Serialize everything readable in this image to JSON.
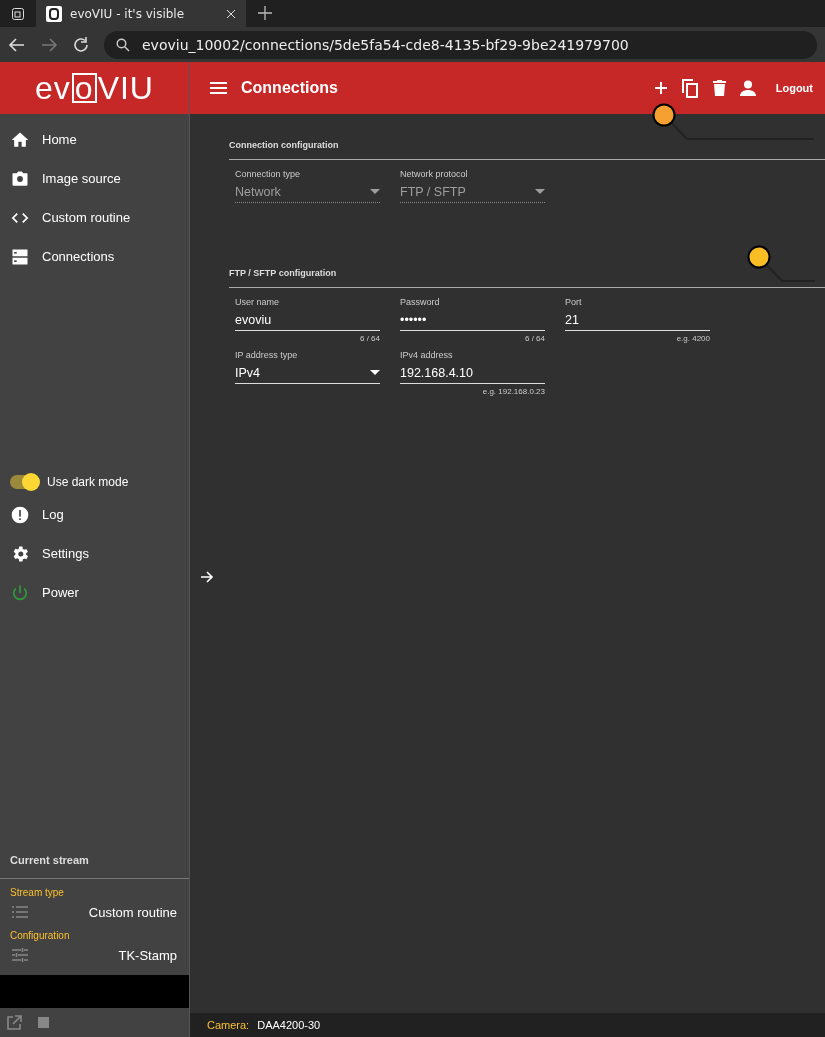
{
  "browser": {
    "tab_title": "evoVIU - it's visible",
    "url": "evoviu_10002/connections/5de5fa54-cde8-4135-bf29-9be241979700"
  },
  "logo": {
    "before": "ev",
    "boxed": "o",
    "after": "VIU"
  },
  "header": {
    "title": "Connections",
    "logout": "Logout"
  },
  "sidebar": {
    "nav": [
      {
        "kind": "home",
        "label": "Home"
      },
      {
        "kind": "camera",
        "label": "Image source"
      },
      {
        "kind": "code",
        "label": "Custom routine"
      },
      {
        "kind": "storage",
        "label": "Connections"
      }
    ],
    "dark_mode": {
      "label": "Use dark mode",
      "on": true
    },
    "bottom": [
      {
        "kind": "alert",
        "label": "Log"
      },
      {
        "kind": "gear",
        "label": "Settings"
      },
      {
        "kind": "power",
        "label": "Power"
      }
    ],
    "current_stream": {
      "title": "Current stream",
      "stream_type_label": "Stream type",
      "stream_type": "Custom routine",
      "configuration_label": "Configuration",
      "configuration": "TK-Stamp"
    }
  },
  "sections": [
    {
      "title": "Connection configuration",
      "rows": [
        [
          {
            "kind": "select",
            "label": "Connection type",
            "value": "Network",
            "disabled": true
          },
          {
            "kind": "select",
            "label": "Network protocol",
            "value": "FTP / SFTP",
            "disabled": true
          }
        ]
      ]
    },
    {
      "title": "FTP / SFTP configuration",
      "rows": [
        [
          {
            "kind": "text",
            "label": "User name",
            "value": "evoviu",
            "hint": "6 / 64",
            "disabled": false
          },
          {
            "kind": "text",
            "label": "Password",
            "value": "••••••",
            "hint": "6 / 64",
            "disabled": false
          },
          {
            "kind": "text",
            "label": "Port",
            "value": "21",
            "hint": "e.g. 4200",
            "disabled": false
          }
        ],
        [
          {
            "kind": "select",
            "label": "IP address type",
            "value": "IPv4",
            "disabled": false
          },
          {
            "kind": "text",
            "label": "IPv4 address",
            "value": "192.168.4.10",
            "hint": "e.g. 192.168.0.23",
            "disabled": false
          }
        ]
      ]
    }
  ],
  "footer": {
    "camera_label": "Camera:",
    "camera": "DAA4200-30"
  }
}
